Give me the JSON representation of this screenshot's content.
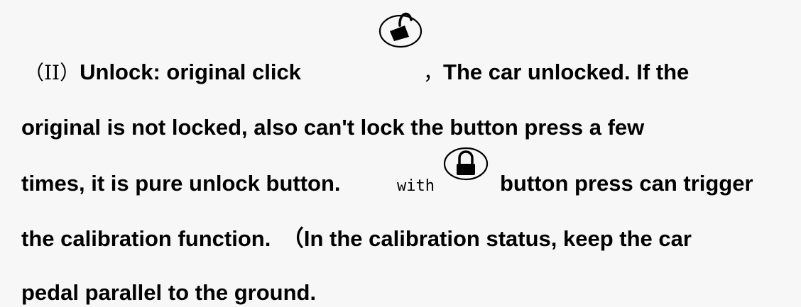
{
  "paragraph": {
    "line1": {
      "prefix": "（II）",
      "bold_a": "Unlock: original click",
      "comma": "，",
      "bold_b": "The car unlocked. If the"
    },
    "line2": "original is not locked, also can't lock the button press a few",
    "line3": {
      "bold_a": "times, it is pure unlock button.",
      "with": "with",
      "bold_b": "button press can trigger"
    },
    "line4": "the calibration function.　（In the calibration status, keep the car",
    "line5": "pedal parallel to the ground."
  },
  "icons": {
    "unlock": "unlock-icon",
    "lock": "lock-icon"
  }
}
